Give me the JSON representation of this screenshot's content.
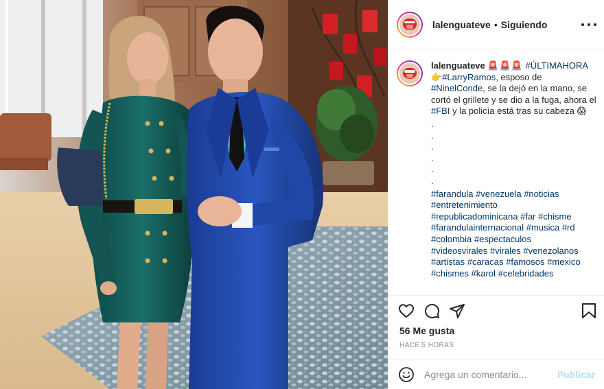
{
  "post": {
    "username": "lalenguateve",
    "follow_status": "Siguiendo",
    "dot_separator": "•",
    "more_icon": "more-horizontal-icon"
  },
  "caption": {
    "username": "lalenguateve",
    "emoji_alert": "🚨🚨🚨",
    "tag_ultimahora": "#ÚLTIMAHORA",
    "emoji_point": "👉",
    "tag_larry": "#LarryRamos",
    "text_1": ", esposo de",
    "tag_ninel": "#NinelConde",
    "text_2": ", se la dejó en la mano, se cortó el grillete y se dio a la fuga, ahora el",
    "tag_fbi": "#FBI",
    "text_3": "y la policía está tras su cabeza",
    "emoji_scream": "😱",
    "dots": [
      ".",
      ".",
      ".",
      ".",
      ".",
      "."
    ],
    "hashtags": [
      "#farandula",
      "#venezuela",
      "#noticias",
      "#entretenimiento",
      "#republicadominicana",
      "#far",
      "#chisme",
      "#farandulainternacional",
      "#musica",
      "#rd",
      "#colombia",
      "#espectaculos",
      "#videosvirales",
      "#virales",
      "#venezolanos",
      "#artistas",
      "#caracas",
      "#famosos",
      "#mexico",
      "#chismes",
      "#karol",
      "#celebridades"
    ]
  },
  "actions": {
    "like_icon": "heart-icon",
    "comment_icon": "comment-icon",
    "share_icon": "share-icon",
    "save_icon": "bookmark-icon",
    "likes": "56 Me gusta",
    "time": "HACE 5 HORAS"
  },
  "comment_box": {
    "placeholder": "Agrega un comentario...",
    "publish_label": "Publicar",
    "emoji_icon": "smiley-icon"
  },
  "colors": {
    "hashtag": "#00376b",
    "publish_disabled": "#b2dffc",
    "muted": "#8e8e8e",
    "border": "#efefef"
  }
}
